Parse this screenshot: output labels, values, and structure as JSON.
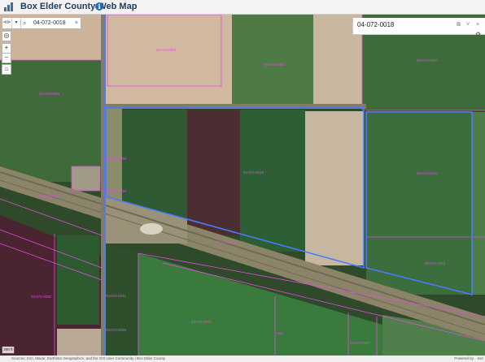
{
  "header": {
    "title": "Box Elder County Web Map",
    "info_icon": "i"
  },
  "search": {
    "value": "04-072-0018",
    "clear_label": "×",
    "magnify_icon": "⌕"
  },
  "toolbar": {
    "zoom_in": "+",
    "zoom_out": "−",
    "home": "⌂",
    "lead_icon": "⊲⊳",
    "drop_icon": "▾"
  },
  "popup": {
    "title": "04-072-0018",
    "dock_icon": "⧉",
    "collapse_icon": "˅",
    "close_icon": "×"
  },
  "scale": {
    "label": "200 ft"
  },
  "footer": {
    "attribution": "Sources: Esri, Maxar, Earthstar Geographics, and the GIS User Community | Box Elder County",
    "powered": "Powered by",
    "esri": "esri"
  },
  "parcels": [
    {
      "id": "04-072-0001",
      "label": "04-072-0001"
    },
    {
      "id": "04-072-0002",
      "label": "04-072-0002"
    },
    {
      "id": "04-072-0003",
      "label": "04-072-0003"
    },
    {
      "id": "04-072-0004",
      "label": "04-072-0004"
    },
    {
      "id": "04-072-0006",
      "label": "04-072-0006"
    },
    {
      "id": "04-072-0018",
      "label": "04-072-0018"
    },
    {
      "id": "04-072-0013",
      "label": "04-072-0013"
    },
    {
      "id": "04-072-0019",
      "label": "04-072-0019"
    },
    {
      "id": "04-072-0023",
      "label": "04-072-0023"
    },
    {
      "id": "04-072-0022",
      "label": "04-072-0022"
    },
    {
      "id": "04-072-0030",
      "label": "04-072-0030"
    },
    {
      "id": "04-072-0031",
      "label": "04-072-0031"
    },
    {
      "id": "04-072-0032",
      "label": "04-072-0032"
    },
    {
      "id": "04-072-0036",
      "label": "04-072-0036"
    },
    {
      "id": "04-072-0037",
      "label": "04-072-0037"
    },
    {
      "id": "04-072-0038",
      "label": "04-072-0038"
    },
    {
      "id": "04-072-0039",
      "label": "04-072-0039"
    },
    {
      "id": "04-072-0040",
      "label": "04-072-0040"
    },
    {
      "id": "04-072-0041",
      "label": "04-072-0041"
    },
    {
      "id": "04-072-0042",
      "label": "04-072-0042"
    },
    {
      "id": "04-072-0043",
      "label": "04-072-0043"
    },
    {
      "id": "04-072-0044",
      "label": "04-072-0044"
    },
    {
      "id": "04-072-0045",
      "label": "04-072-0045"
    },
    {
      "id": "04-072-0046",
      "label": "04-072-0046"
    },
    {
      "id": "04-072-0047",
      "label": "04-072-0047"
    },
    {
      "id": "hwy",
      "label": "Hwy"
    }
  ],
  "colors": {
    "parcel_line": "#e24de0",
    "selected_outline": "#4a7bff",
    "header_text": "#1f3a5f"
  }
}
